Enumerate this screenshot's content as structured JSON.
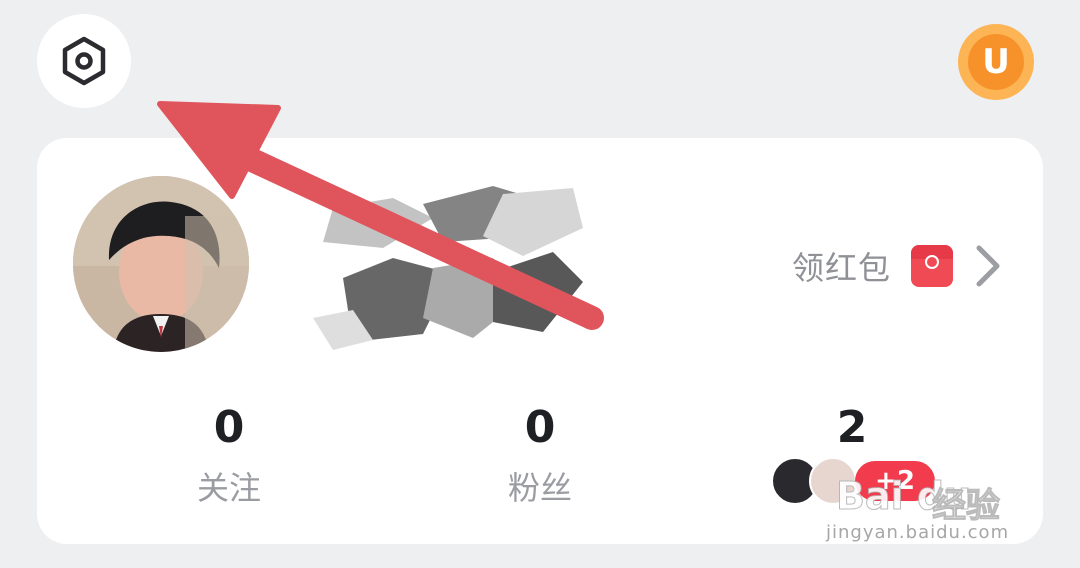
{
  "header": {
    "settings_icon": "settings-hexagon-icon",
    "coin_letter": "U",
    "coin_icon": "coin-icon"
  },
  "profile": {
    "avatar_icon": "user-avatar",
    "red_packet_label": "领红包",
    "red_packet_icon": "red-packet-icon",
    "chevron_icon": "chevron-right-icon"
  },
  "stats": [
    {
      "value": "0",
      "label": "关注"
    },
    {
      "value": "0",
      "label": "粉丝"
    },
    {
      "value": "2",
      "label": ""
    }
  ],
  "friends": {
    "add_label": "+2"
  },
  "colors": {
    "background": "#eeeff1",
    "card": "#ffffff",
    "accent_red": "#f23b4d",
    "coin_orange": "#f7922a",
    "annotation_arrow": "#e0545c"
  },
  "watermark": {
    "logo": "Bai du",
    "brand": "经验",
    "url": "jingyan.baidu.com"
  }
}
